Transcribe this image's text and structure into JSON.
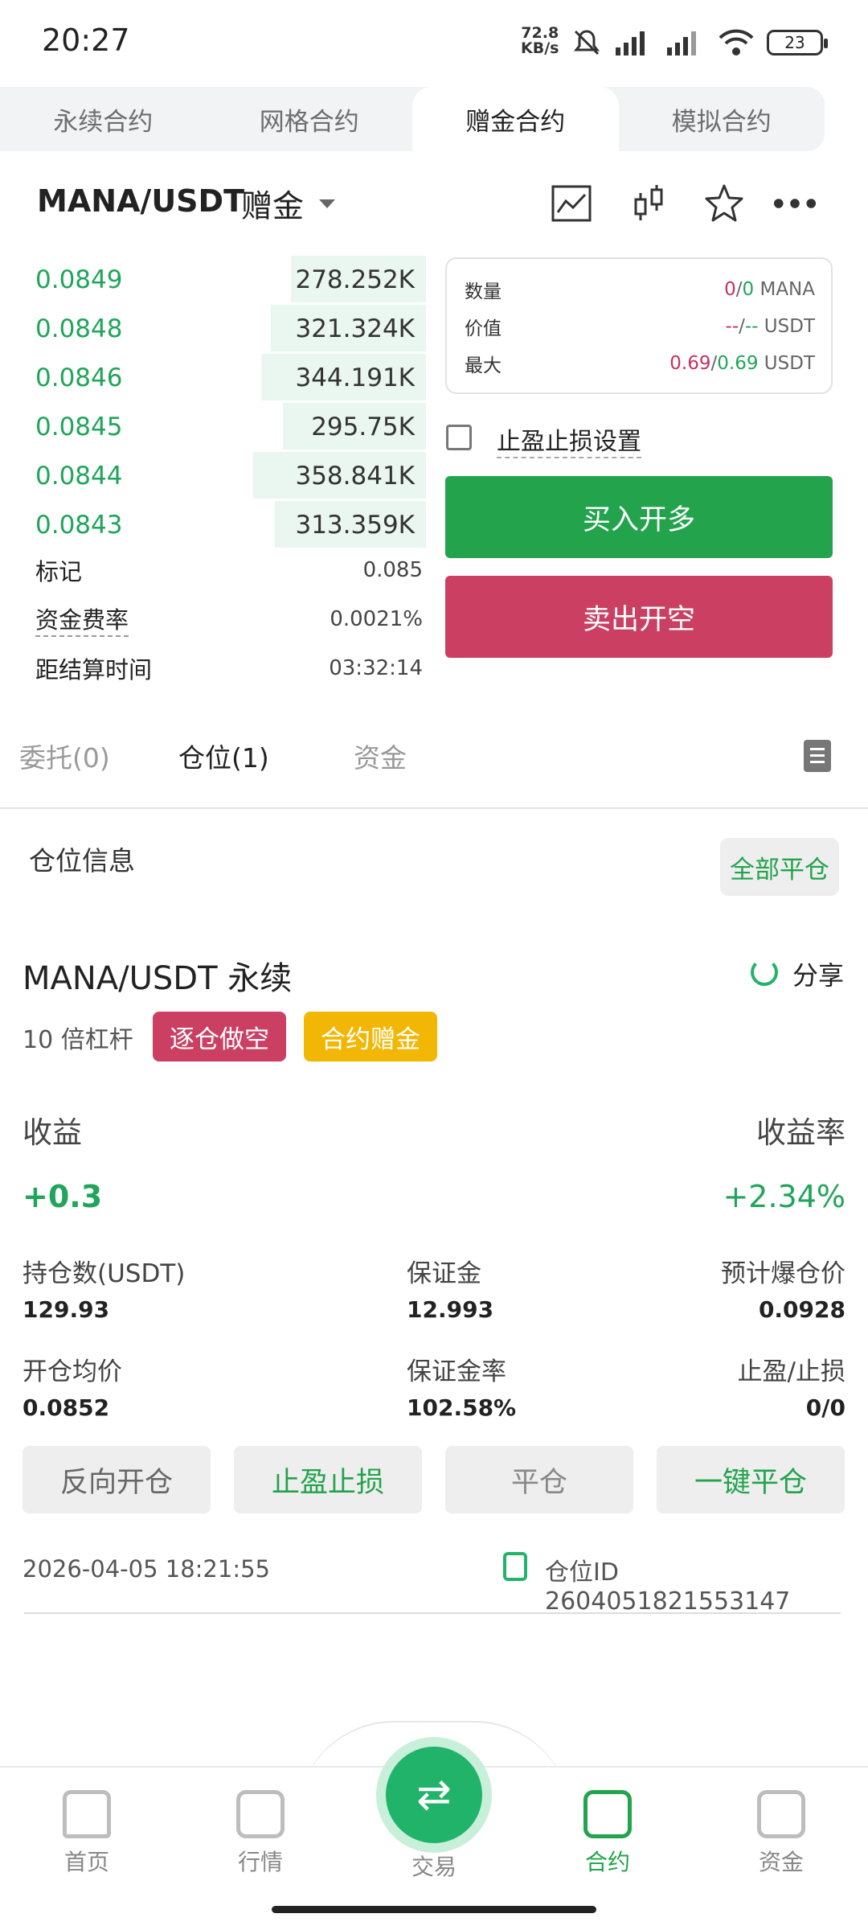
{
  "status": {
    "time": "20:27",
    "net_speed": "72.8",
    "net_unit": "KB/s",
    "battery": "23"
  },
  "top_tabs": [
    {
      "label": "永续合约"
    },
    {
      "label": "网格合约"
    },
    {
      "label": "赠金合约"
    },
    {
      "label": "模拟合约"
    }
  ],
  "header": {
    "pair": "MANA/USDT",
    "tag": "赠金"
  },
  "orderbook": [
    {
      "price": "0.0849",
      "qty": "278.252K",
      "fill": 0.67
    },
    {
      "price": "0.0848",
      "qty": "321.324K",
      "fill": 0.77
    },
    {
      "price": "0.0846",
      "qty": "344.191K",
      "fill": 0.82
    },
    {
      "price": "0.0845",
      "qty": "295.75K",
      "fill": 0.71
    },
    {
      "price": "0.0844",
      "qty": "358.841K",
      "fill": 0.86
    },
    {
      "price": "0.0843",
      "qty": "313.359K",
      "fill": 0.75
    }
  ],
  "market_info": {
    "mark_label": "标记",
    "mark_value": "0.085",
    "funding_label": "资金费率",
    "funding_value": "0.0021%",
    "settle_label": "距结算时间",
    "settle_value": "03:32:14"
  },
  "order_panel": {
    "qty_label": "数量",
    "qty_a": "0",
    "qty_sep": "/",
    "qty_b": "0",
    "qty_unit": "MANA",
    "value_label": "价值",
    "value_a": "--",
    "value_sep": "/",
    "value_b": "--",
    "value_unit": "USDT",
    "max_label": "最大",
    "max_a": "0.69",
    "max_sep": "/",
    "max_b": "0.69",
    "max_unit": "USDT",
    "tpsl_label": "止盈止损设置",
    "buy_label": "买入开多",
    "sell_label": "卖出开空"
  },
  "sub_tabs": [
    {
      "label": "委托(0)"
    },
    {
      "label": "仓位(1)"
    },
    {
      "label": "资金"
    }
  ],
  "position": {
    "section_title": "仓位信息",
    "close_all": "全部平仓",
    "pair": "MANA/USDT 永续",
    "share": "分享",
    "leverage": "10 倍杠杆",
    "badge_mode": "逐仓做空",
    "badge_bonus": "合约赠金",
    "pnl_label": "收益",
    "roi_label": "收益率",
    "pnl_value": "+0.3",
    "roi_value": "+2.34%",
    "size_label": "持仓数(USDT)",
    "size_value": "129.93",
    "margin_label": "保证金",
    "margin_value": "12.993",
    "liq_label": "预计爆仓价",
    "liq_value": "0.0928",
    "entry_label": "开仓均价",
    "entry_value": "0.0852",
    "margin_rate_label": "保证金率",
    "margin_rate_value": "102.58%",
    "tpsl_label": "止盈/止损",
    "tpsl_value": "0/0",
    "actions": {
      "reverse": "反向开仓",
      "tpsl": "止盈止损",
      "close": "平仓",
      "quick_close": "一键平仓"
    },
    "timestamp": "2026-04-05 18:21:55",
    "position_id": "仓位ID 2604051821553147"
  },
  "nav": {
    "home": "首页",
    "market": "行情",
    "trade": "交易",
    "contract": "合约",
    "assets": "资金"
  },
  "colors": {
    "green": "#22a34c",
    "red": "#ca3f62",
    "yellow": "#f2b705"
  }
}
